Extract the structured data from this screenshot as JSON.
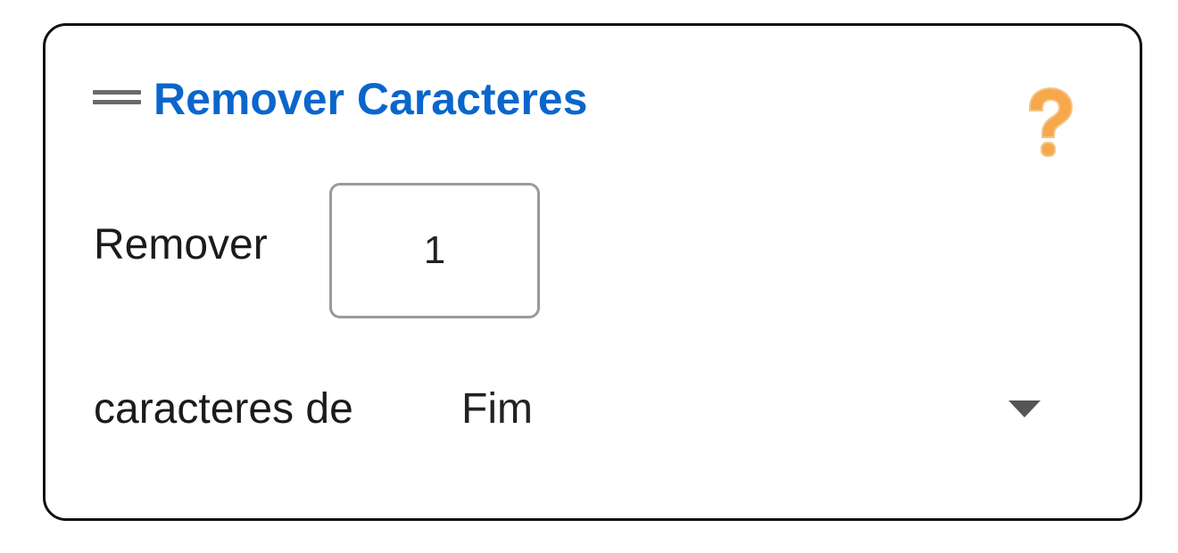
{
  "block": {
    "title": "Remover Caracteres",
    "help_icon": "question-mark-icon",
    "drag_icon": "drag-handle-icon",
    "remove_label": "Remover",
    "count_value": "1",
    "from_label": "caracteres de",
    "position_selected": "Fim",
    "dropdown_icon": "chevron-down-icon"
  },
  "colors": {
    "title": "#0a66cc",
    "help_icon": "#f7a84a",
    "border": "#111111",
    "input_border": "#9a9a9a"
  }
}
